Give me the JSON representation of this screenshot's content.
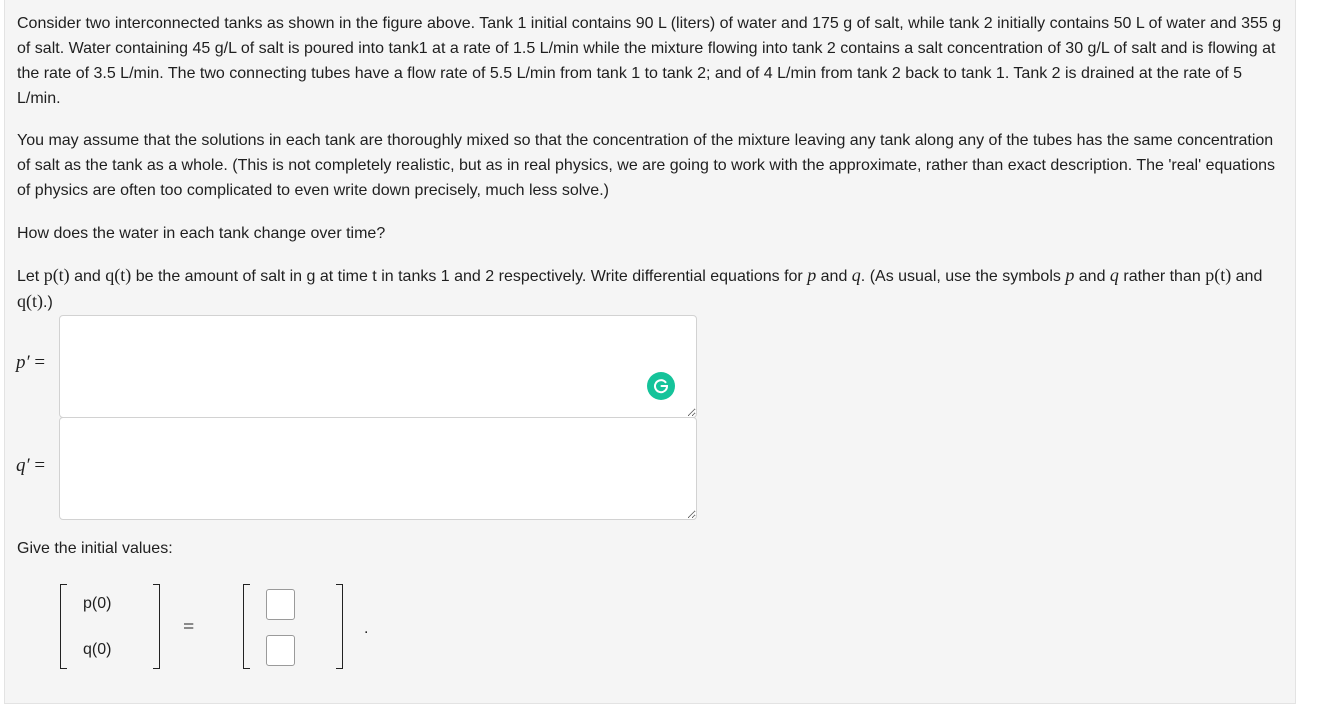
{
  "problem": {
    "para1": "Consider two interconnected tanks as shown in the figure above. Tank 1 initial contains 90 L (liters) of water and 175 g of salt, while tank 2 initially contains 50 L of water and 355 g of salt. Water containing 45 g/L of salt is poured into tank1 at a rate of 1.5 L/min while the mixture flowing into tank 2 contains a salt concentration of 30 g/L of salt and is flowing at the rate of 3.5 L/min. The two connecting tubes have a flow rate of 5.5 L/min from tank 1 to tank 2; and of 4 L/min from tank 2 back to tank 1. Tank 2 is drained at the rate of 5 L/min.",
    "para2": "You may assume that the solutions in each tank are thoroughly mixed so that the concentration of the mixture leaving any tank along any of the tubes has the same concentration of salt as the tank as a whole. (This is not completely realistic, but as in real physics, we are going to work with the approximate, rather than exact description. The 'real' equations of physics are often too complicated to even write down precisely, much less solve.)",
    "para3": "How does the water in each tank change over time?",
    "para4": {
      "t1": "Let ",
      "m1": "p(t)",
      "t2": " and ",
      "m2": "q(t)",
      "t3": " be the amount of salt in g at time t in tanks 1 and 2 respectively. Write differential equations for ",
      "m3": "p",
      "t4": " and ",
      "m4": "q",
      "t5": ". (As usual, use the symbols ",
      "m5": "p",
      "t6": " and ",
      "m6": "q",
      "t7": " rather than ",
      "m7": "p(t)",
      "t8": " and ",
      "m8": "q(t)",
      "t9": ".)"
    }
  },
  "equations": {
    "p_label": "p′",
    "q_label": "q′",
    "equals": "=",
    "p_value": "",
    "q_value": ""
  },
  "initial": {
    "prompt": "Give the initial values:",
    "p0_label": "p(0)",
    "q0_label": "q(0)",
    "equals": "=",
    "p0_value": "",
    "q0_value": "",
    "terminator": "."
  },
  "icons": {
    "grammarly": "grammarly-icon"
  },
  "colors": {
    "panel_bg": "#f5f5f5",
    "grammarly": "#15c39a"
  }
}
